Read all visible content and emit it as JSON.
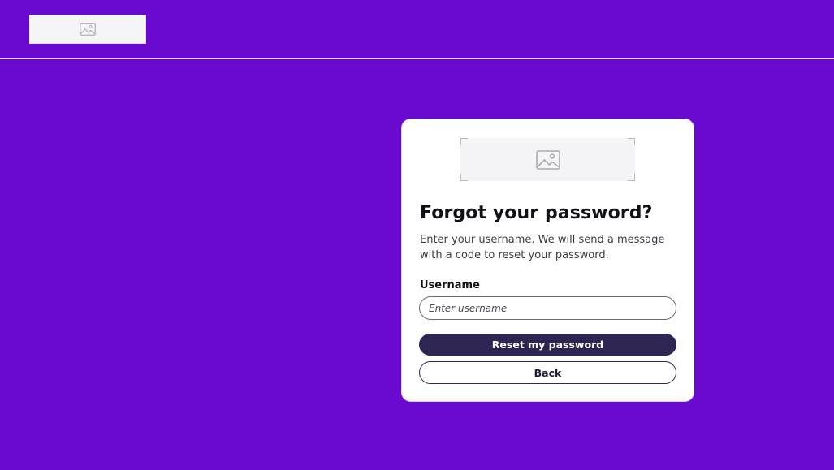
{
  "header": {
    "logo_icon": "image-placeholder-icon"
  },
  "card": {
    "image_icon": "image-placeholder-icon",
    "title": "Forgot your password?",
    "description": "Enter your username. We will send a message with a code to reset your password.",
    "username_label": "Username",
    "username_placeholder": "Enter username",
    "username_value": "",
    "reset_button_label": "Reset my password",
    "back_button_label": "Back"
  },
  "colors": {
    "background": "#6a0acf",
    "primary_button": "#2e2552",
    "card": "#ffffff"
  }
}
